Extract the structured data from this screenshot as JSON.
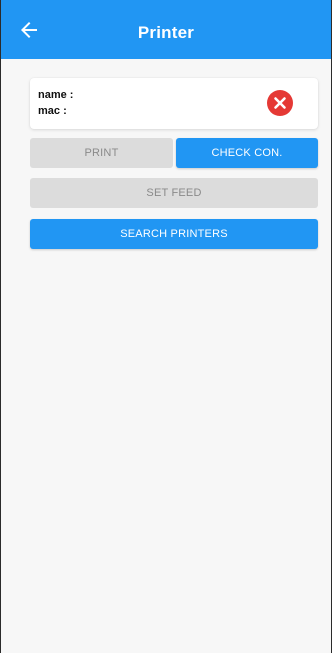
{
  "appbar": {
    "title": "Printer",
    "back_icon": "arrow-left-icon",
    "color": "#2196f3"
  },
  "printer_info": {
    "name_label": "name :",
    "mac_label": "mac :",
    "status_icon": "close-circle-icon",
    "status_color": "#e53935"
  },
  "actions": {
    "print_label": "PRINT",
    "check_label": "CHECK CON.",
    "feed_label": "SET FEED",
    "search_label": "SEARCH PRINTERS"
  }
}
